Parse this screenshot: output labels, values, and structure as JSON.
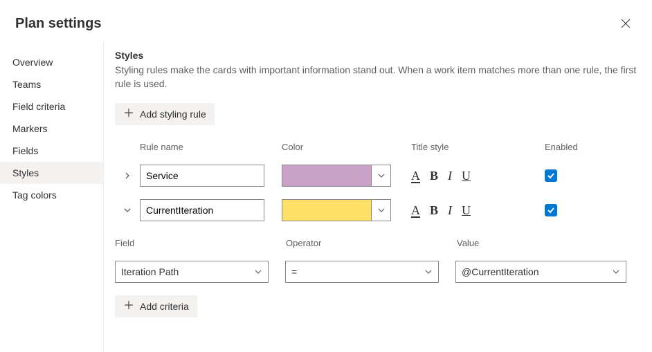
{
  "header": {
    "title": "Plan settings"
  },
  "sidebar": {
    "items": [
      {
        "label": "Overview"
      },
      {
        "label": "Teams"
      },
      {
        "label": "Field criteria"
      },
      {
        "label": "Markers"
      },
      {
        "label": "Fields"
      },
      {
        "label": "Styles"
      },
      {
        "label": "Tag colors"
      }
    ],
    "activeIndex": 5
  },
  "styles": {
    "title": "Styles",
    "description": "Styling rules make the cards with important information stand out. When a work item matches more than one rule, the first rule is used.",
    "addRuleLabel": "Add styling rule",
    "columns": {
      "name": "Rule name",
      "color": "Color",
      "titleStyle": "Title style",
      "enabled": "Enabled"
    },
    "rules": [
      {
        "name": "Service",
        "color": "#c8a2c8",
        "expanded": false,
        "enabled": true
      },
      {
        "name": "CurrentIteration",
        "color": "#ffe066",
        "expanded": true,
        "enabled": true
      }
    ],
    "titleStyleGlyphs": {
      "a": "A",
      "b": "B",
      "i": "I",
      "u": "U"
    },
    "criteria": {
      "columns": {
        "field": "Field",
        "operator": "Operator",
        "value": "Value"
      },
      "row": {
        "field": "Iteration Path",
        "operator": "=",
        "value": "@CurrentIteration"
      },
      "addCriteriaLabel": "Add criteria"
    }
  }
}
